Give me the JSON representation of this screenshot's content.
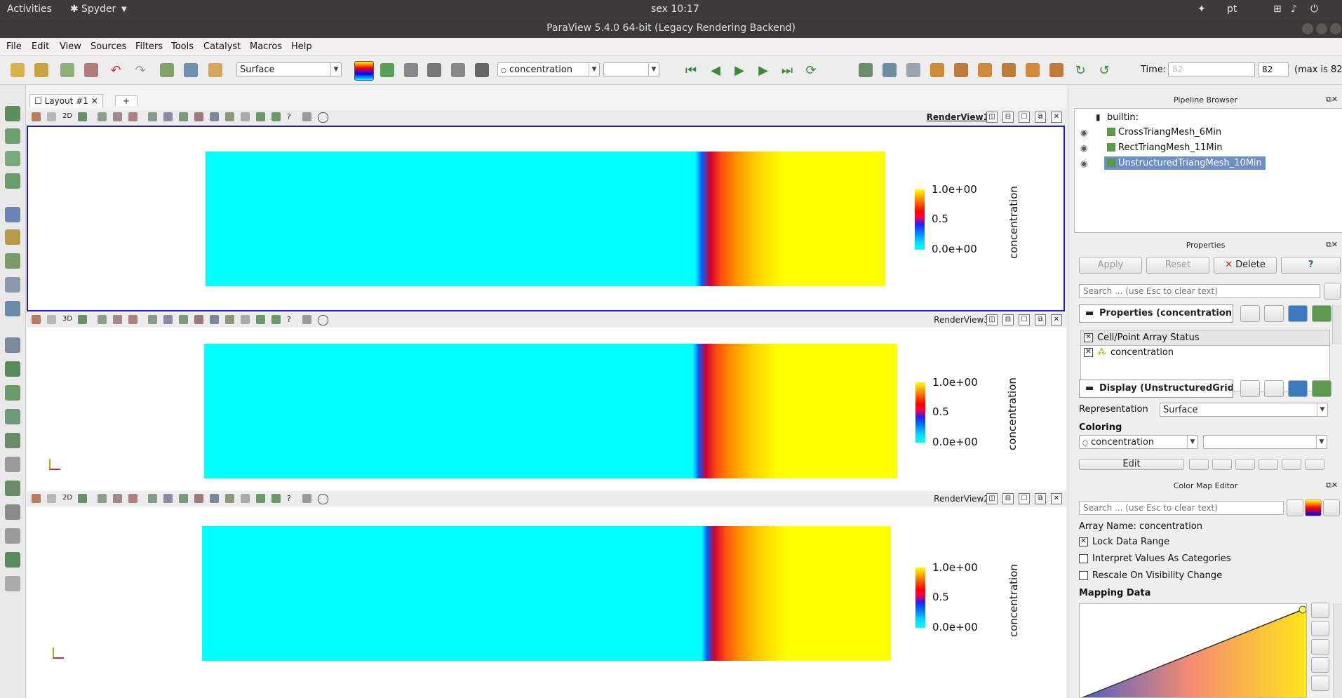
{
  "system_bar": {
    "activities": "Activities",
    "app_name": "Spyder",
    "clock": "sex 10:17",
    "lang": "pt"
  },
  "window": {
    "title": "ParaView 5.4.0 64-bit (Legacy Rendering Backend)"
  },
  "menu": [
    "File",
    "Edit",
    "View",
    "Sources",
    "Filters",
    "Tools",
    "Catalyst",
    "Macros",
    "Help"
  ],
  "toolbar": {
    "representation": "Surface",
    "color_array": "concentration",
    "component": "",
    "time_label": "Time:",
    "time_value": "82",
    "time_index": "82",
    "time_max": "(max is 82)"
  },
  "layout": {
    "tab_label": "Layout #1",
    "add_tab": "+"
  },
  "views": [
    {
      "name": "RenderView1",
      "mode": "2D",
      "active": true
    },
    {
      "name": "RenderView3",
      "mode": "3D",
      "active": false
    },
    {
      "name": "RenderView2",
      "mode": "2D",
      "active": false
    }
  ],
  "colorbar": {
    "top": "1.0e+00",
    "mid": "0.5",
    "bottom": "0.0e+00",
    "title": "concentration"
  },
  "pipeline": {
    "title": "Pipeline Browser",
    "root": "builtin:",
    "items": [
      "CrossTriangMesh_6Min",
      "RectTriangMesh_11Min",
      "UnstructuredTriangMesh_10Min"
    ],
    "selected_index": 2
  },
  "properties": {
    "title": "Properties",
    "apply": "Apply",
    "reset": "Reset",
    "delete": "Delete",
    "help": "?",
    "search_placeholder": "Search ... (use Esc to clear text)",
    "section_properties": "Properties (concentration)",
    "array_status_header": "Cell/Point Array Status",
    "array_item": "concentration",
    "section_display": "Display (UnstructuredGrid)",
    "representation_label": "Representation",
    "representation_value": "Surface",
    "coloring_label": "Coloring",
    "coloring_value": "concentration",
    "edit": "Edit"
  },
  "color_map_editor": {
    "title": "Color Map Editor",
    "search_placeholder": "Search ... (use Esc to clear text)",
    "array_name": "Array Name: concentration",
    "lock_data_range": "Lock Data Range",
    "lock_checked": true,
    "interpret_categories": "Interpret Values As Categories",
    "interpret_checked": false,
    "rescale_visibility": "Rescale On Visibility Change",
    "rescale_checked": false,
    "mapping_data": "Mapping Data"
  },
  "colors": {
    "accent_selected": "#6c8fc7",
    "active_view_border": "#1a1acc",
    "low": "#00ffff",
    "high": "#ffff00"
  }
}
